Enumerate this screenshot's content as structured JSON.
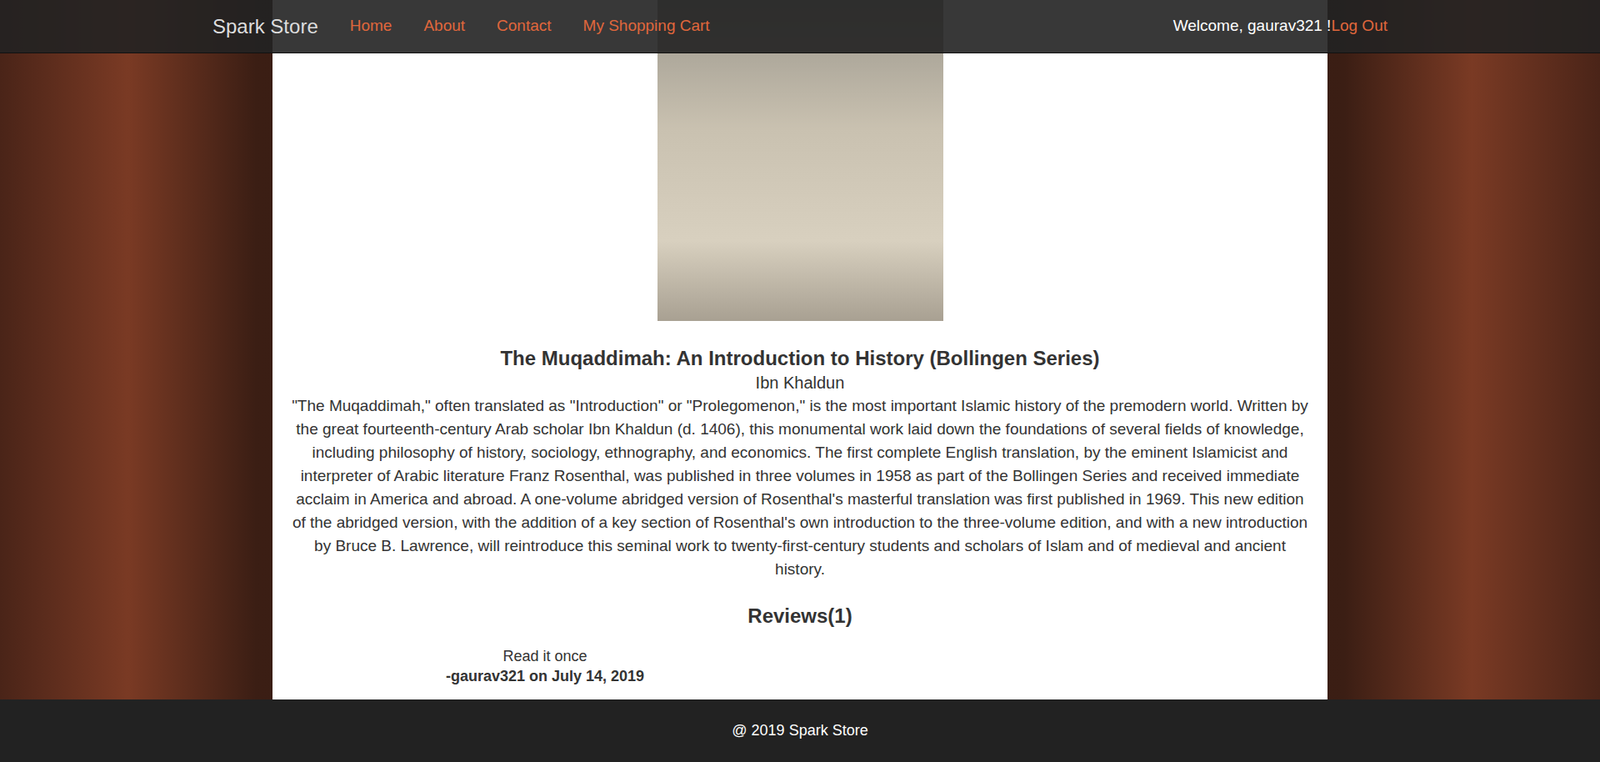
{
  "navbar": {
    "brand": "Spark Store",
    "links": [
      {
        "label": "Home",
        "selected": false
      },
      {
        "label": "About",
        "selected": false
      },
      {
        "label": "Contact",
        "selected": false
      },
      {
        "label": "My Shopping Cart",
        "selected": false
      }
    ],
    "welcome": "Welcome, gaurav321 !",
    "logout": "Log Out"
  },
  "book": {
    "title": "The Muqaddimah: An Introduction to History (Bollingen Series)",
    "author": "Ibn Khaldun",
    "description": "\"The Muqaddimah,\" often translated as \"Introduction\" or \"Prolegomenon,\" is the most important Islamic history of the premodern world. Written by the great fourteenth-century Arab scholar Ibn Khaldun (d. 1406), this monumental work laid down the foundations of several fields of knowledge, including philosophy of history, sociology, ethnography, and economics. The first complete English translation, by the eminent Islamicist and interpreter of Arabic literature Franz Rosenthal, was published in three volumes in 1958 as part of the Bollingen Series and received immediate acclaim in America and abroad. A one-volume abridged version of Rosenthal's masterful translation was first published in 1969. This new edition of the abridged version, with the addition of a key section of Rosenthal's own introduction to the three-volume edition, and with a new introduction by Bruce B. Lawrence, will reintroduce this seminal work to twenty-first-century students and scholars of Islam and of medieval and ancient history."
  },
  "reviews": {
    "heading": "Reviews(1)",
    "items": [
      {
        "text": "Read it once",
        "byline": "-gaurav321 on July 14, 2019"
      }
    ]
  },
  "footer": "@ 2019 Spark Store"
}
